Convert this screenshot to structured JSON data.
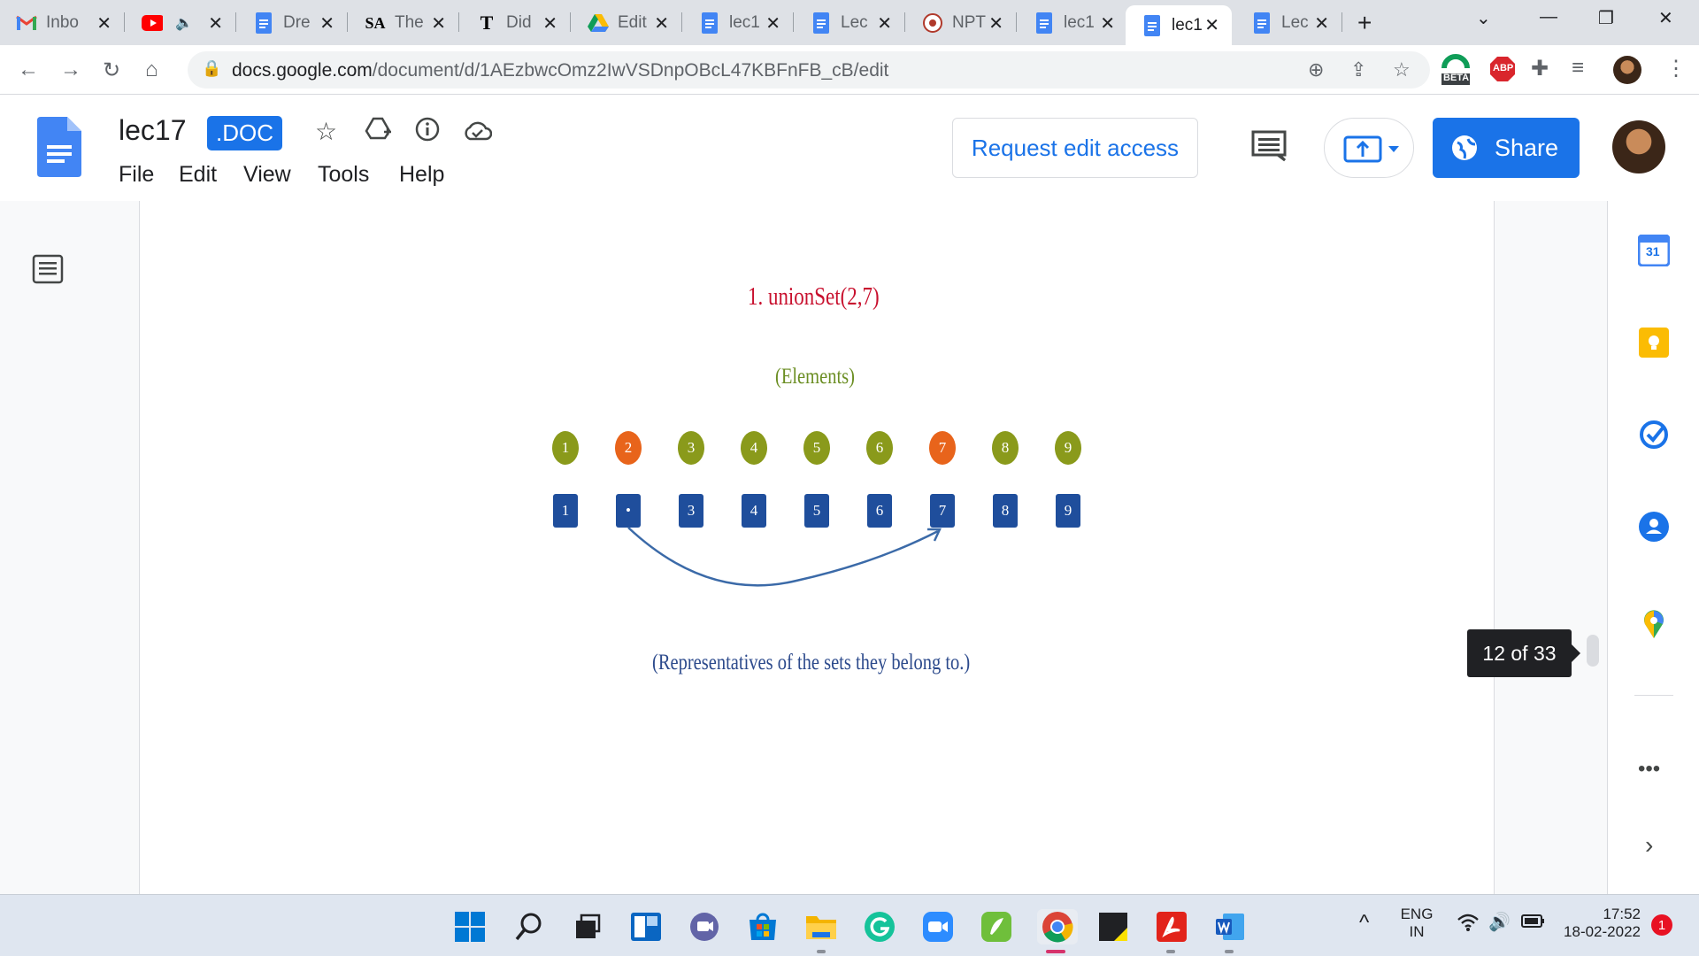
{
  "browser": {
    "tabs": [
      {
        "title": "Inbo",
        "icon": "gmail-icon"
      },
      {
        "title": "",
        "icon": "youtube-icon",
        "audio": true
      },
      {
        "title": "Dre",
        "icon": "docs-icon"
      },
      {
        "title": "The",
        "icon": "sa-icon"
      },
      {
        "title": "Did",
        "icon": "nyt-icon"
      },
      {
        "title": "Edit",
        "icon": "drive-icon"
      },
      {
        "title": "lec1",
        "icon": "docs-icon"
      },
      {
        "title": "Lec",
        "icon": "docs-icon"
      },
      {
        "title": "NPT",
        "icon": "nptel-icon"
      },
      {
        "title": "lec1",
        "icon": "docs-icon"
      },
      {
        "title": "lec1",
        "icon": "docs-icon",
        "active": true
      },
      {
        "title": "Lec",
        "icon": "docs-icon"
      }
    ],
    "url_host": "docs.google.com",
    "url_path": "/document/d/1AEzbwcOmz2IwVSDnpOBcL47KBFnFB_cB/edit",
    "beta_label": "BETA",
    "abp_label": "ABP"
  },
  "doc": {
    "title": "lec17",
    "badge": ".DOC",
    "menu": [
      "File",
      "Edit",
      "View",
      "Tools",
      "Help"
    ],
    "request_label": "Request edit access",
    "share_label": "Share",
    "page_indicator": "12 of 33"
  },
  "figure": {
    "title": "1. unionSet(2,7)",
    "subtitle": "(Elements)",
    "caption": "(Representatives of the sets they belong to.)",
    "elements": [
      "1",
      "2",
      "3",
      "4",
      "5",
      "6",
      "7",
      "8",
      "9"
    ],
    "highlighted": [
      "2",
      "7"
    ],
    "representatives": [
      "1",
      "•",
      "3",
      "4",
      "5",
      "6",
      "7",
      "8",
      "9"
    ],
    "colors": {
      "element": "#8a9a1b",
      "highlight": "#e8641b",
      "representative": "#1f4e9c",
      "arrow": "#3b6aa8"
    }
  },
  "sidepanel": {
    "calendar_day": "31"
  },
  "taskbar": {
    "lang": "ENG",
    "region": "IN",
    "time": "17:52",
    "date": "18-02-2022",
    "notifications": "1"
  }
}
